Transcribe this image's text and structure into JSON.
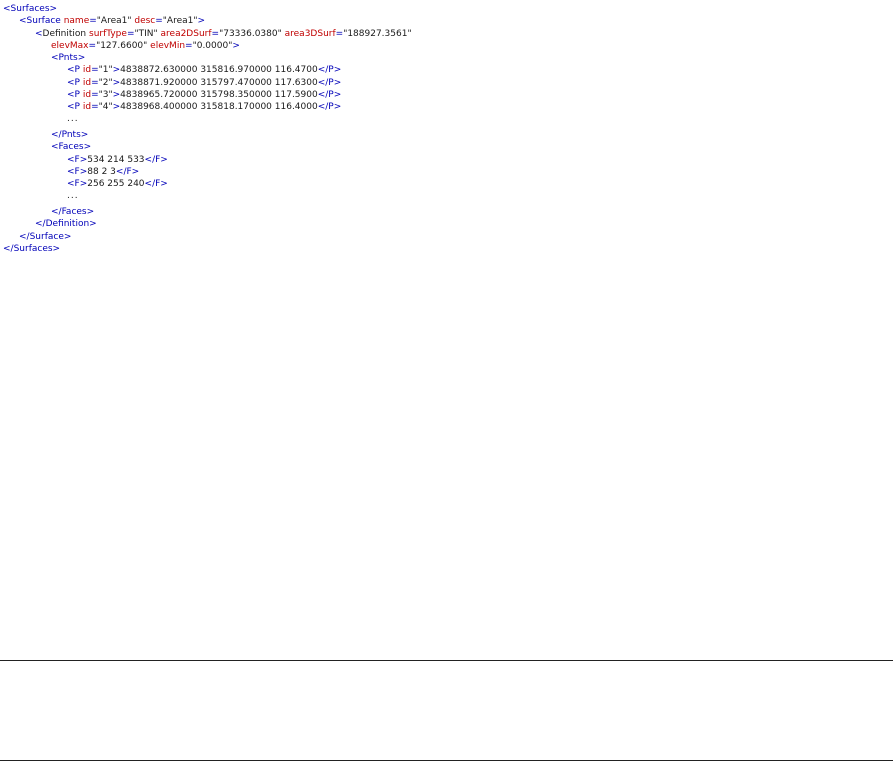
{
  "xml": {
    "lines": [
      {
        "indent": 0,
        "parts": [
          {
            "k": "tag",
            "t": "<Surfaces>"
          }
        ]
      },
      {
        "indent": 16,
        "parts": [
          {
            "k": "tag",
            "t": "<Surface "
          },
          {
            "k": "attr",
            "t": "name"
          },
          {
            "k": "tag",
            "t": "="
          },
          {
            "k": "val",
            "t": "\"Area1\" "
          },
          {
            "k": "attr",
            "t": "desc"
          },
          {
            "k": "tag",
            "t": "="
          },
          {
            "k": "val",
            "t": "\"Area1\""
          },
          {
            "k": "tag",
            "t": ">"
          }
        ]
      },
      {
        "indent": 32,
        "parts": [
          {
            "k": "tag",
            "t": "<"
          },
          {
            "k": "txt",
            "t": "Definition "
          },
          {
            "k": "attr",
            "t": "surfType"
          },
          {
            "k": "tag",
            "t": "="
          },
          {
            "k": "val",
            "t": "\"TIN\" "
          },
          {
            "k": "attr",
            "t": "area2DSurf"
          },
          {
            "k": "tag",
            "t": "="
          },
          {
            "k": "val",
            "t": "\"73336.0380\" "
          },
          {
            "k": "attr",
            "t": "area3DSurf"
          },
          {
            "k": "tag",
            "t": "="
          },
          {
            "k": "val",
            "t": "\"188927.3561\""
          }
        ]
      },
      {
        "indent": 48,
        "parts": [
          {
            "k": "attr",
            "t": "elevMax"
          },
          {
            "k": "tag",
            "t": "="
          },
          {
            "k": "val",
            "t": "\"127.6600\" "
          },
          {
            "k": "attr",
            "t": "elevMin"
          },
          {
            "k": "tag",
            "t": "="
          },
          {
            "k": "val",
            "t": "\"0.0000\""
          },
          {
            "k": "tag",
            "t": ">"
          }
        ]
      },
      {
        "indent": 48,
        "parts": [
          {
            "k": "tag",
            "t": "<Pnts>"
          }
        ]
      },
      {
        "indent": 64,
        "parts": [
          {
            "k": "tag",
            "t": "<P "
          },
          {
            "k": "attr",
            "t": "id"
          },
          {
            "k": "tag",
            "t": "="
          },
          {
            "k": "val",
            "t": "\"1\""
          },
          {
            "k": "tag",
            "t": ">"
          },
          {
            "k": "txt",
            "t": "4838872.630000 315816.970000 116.4700"
          },
          {
            "k": "tag",
            "t": "</P>"
          }
        ]
      },
      {
        "indent": 64,
        "parts": [
          {
            "k": "tag",
            "t": "<P "
          },
          {
            "k": "attr",
            "t": "id"
          },
          {
            "k": "tag",
            "t": "="
          },
          {
            "k": "val",
            "t": "\"2\""
          },
          {
            "k": "tag",
            "t": ">"
          },
          {
            "k": "txt",
            "t": "4838871.920000 315797.470000 117.6300"
          },
          {
            "k": "tag",
            "t": "</P>"
          }
        ]
      },
      {
        "indent": 64,
        "parts": [
          {
            "k": "tag",
            "t": "<P "
          },
          {
            "k": "attr",
            "t": "id"
          },
          {
            "k": "tag",
            "t": "="
          },
          {
            "k": "val",
            "t": "\"3\""
          },
          {
            "k": "tag",
            "t": ">"
          },
          {
            "k": "txt",
            "t": "4838965.720000 315798.350000 117.5900"
          },
          {
            "k": "tag",
            "t": "</P>"
          }
        ]
      },
      {
        "indent": 64,
        "parts": [
          {
            "k": "tag",
            "t": "<P "
          },
          {
            "k": "attr",
            "t": "id"
          },
          {
            "k": "tag",
            "t": "="
          },
          {
            "k": "val",
            "t": "\"4\""
          },
          {
            "k": "tag",
            "t": ">"
          },
          {
            "k": "txt",
            "t": "4838968.400000 315818.170000 116.4000"
          },
          {
            "k": "tag",
            "t": "</P>"
          }
        ]
      },
      {
        "indent": 64,
        "parts": [
          {
            "k": "ellipsis",
            "t": "..."
          }
        ]
      },
      {
        "indent": 48,
        "parts": [
          {
            "k": "tag",
            "t": "</Pnts>"
          }
        ]
      },
      {
        "indent": 48,
        "parts": [
          {
            "k": "tag",
            "t": "<Faces>"
          }
        ]
      },
      {
        "indent": 64,
        "parts": [
          {
            "k": "tag",
            "t": "<F>"
          },
          {
            "k": "txt",
            "t": "534 214 533"
          },
          {
            "k": "tag",
            "t": "</F>"
          }
        ]
      },
      {
        "indent": 64,
        "parts": [
          {
            "k": "tag",
            "t": "<F>"
          },
          {
            "k": "txt",
            "t": "88 2 3"
          },
          {
            "k": "tag",
            "t": "</F>"
          }
        ]
      },
      {
        "indent": 64,
        "parts": [
          {
            "k": "tag",
            "t": "<F>"
          },
          {
            "k": "txt",
            "t": "256 255 240"
          },
          {
            "k": "tag",
            "t": "</F>"
          }
        ]
      },
      {
        "indent": 64,
        "parts": [
          {
            "k": "ellipsis",
            "t": "..."
          }
        ]
      },
      {
        "indent": 48,
        "parts": [
          {
            "k": "tag",
            "t": "</Faces>"
          }
        ]
      },
      {
        "indent": 32,
        "parts": [
          {
            "k": "tag",
            "t": "</Definition>"
          }
        ]
      },
      {
        "indent": 16,
        "parts": [
          {
            "k": "tag",
            "t": "</Surface>"
          }
        ]
      },
      {
        "indent": 0,
        "parts": [
          {
            "k": "tag",
            "t": "</Surfaces>"
          }
        ]
      }
    ]
  },
  "colors": {
    "tag": "#0000b8",
    "attr": "#c00000",
    "text": "#1a1a1a",
    "rule": "#222222"
  }
}
